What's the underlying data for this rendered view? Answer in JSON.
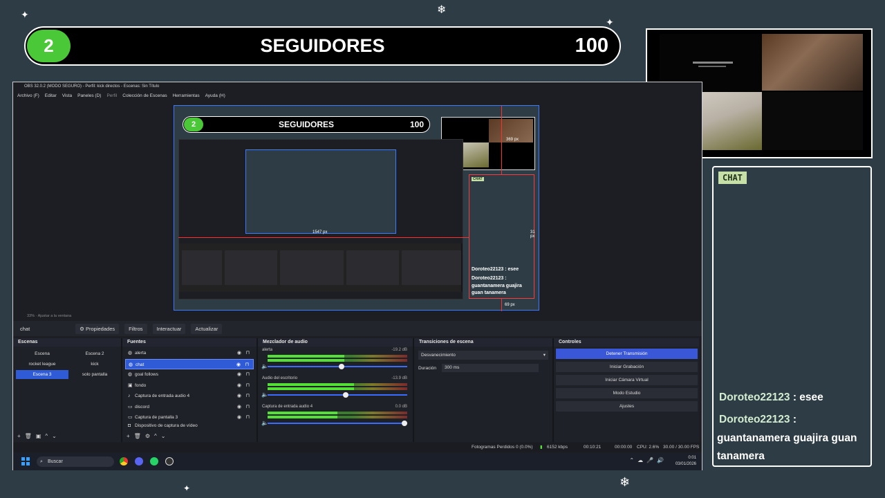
{
  "follower_goal": {
    "current": "2",
    "label": "SEGUIDORES",
    "goal": "100",
    "badge_color": "#4bc838"
  },
  "chat": {
    "tag": "CHAT",
    "messages": [
      {
        "user": "Doroteo22123",
        "separator": " : ",
        "text": "esee"
      },
      {
        "user": "Doroteo22123",
        "separator": " :",
        "text": "guantanamera guajira guan tanamera"
      }
    ]
  },
  "obs": {
    "title": "OBS 32.0.2 (MODO SEGURO) - Perfil: kick directos - Escenas: Sin Título",
    "menu": [
      "Archivo (F)",
      "Editar",
      "Vista",
      "Paneles (D)",
      "Perfil",
      "Colección de Escenas",
      "Herramientas",
      "Ayuda (H)"
    ],
    "preview": {
      "bar_current": "2",
      "bar_label": "SEGUIDORES",
      "bar_goal": "100",
      "chat_tag": "CHAT",
      "chat_lines": [
        "Doroteo22123 : esee",
        "Doroteo22123 :",
        "guantanamera guajira guan tanamera"
      ],
      "px_labels": [
        "369 px",
        "1547 px",
        "31 px",
        "69 px"
      ]
    },
    "canvas_info": "33% · Ajustar a la ventana",
    "current_source": "chat",
    "source_toolbar": [
      "⚙ Propiedades",
      "Filtros",
      "Interactuar",
      "Actualizar"
    ],
    "docks": {
      "scenes": {
        "title": "Escenas",
        "items": [
          "Escena",
          "Escena 2",
          "rocket league",
          "kick",
          "Escena 3",
          "solo pantalla"
        ],
        "active": "Escena 3"
      },
      "sources": {
        "title": "Fuentes",
        "items": [
          "alerta",
          "chat",
          "goal follows",
          "fondo",
          "Captura de entrada audio 4",
          "discord",
          "Captura de pantalla 3",
          "Dispositivo de captura de vídeo"
        ],
        "active": "chat"
      },
      "mixer": {
        "title": "Mezclador de audio",
        "channels": [
          {
            "name": "alerta",
            "db": "-19.2 dB",
            "level": 0.55,
            "fader": 0.55
          },
          {
            "name": "Audio del escritorio",
            "db": "-13.9 dB",
            "level": 0.62,
            "fader": 0.58
          },
          {
            "name": "Captura de entrada audio 4",
            "db": "0.0 dB",
            "level": 0.5,
            "fader": 1.0
          }
        ]
      },
      "transitions": {
        "title": "Transiciones de escena",
        "selected": "Desvanecimiento",
        "duration_label": "Duración",
        "duration_value": "300 ms"
      },
      "controls": {
        "title": "Controles",
        "buttons": [
          "Detener Transmisión",
          "Iniciar Grabación",
          "Iniciar Cámara Virtual",
          "Modo Estudio",
          "Ajustes"
        ]
      }
    },
    "status": {
      "dropped": "Fotogramas Perdidos 0 (0.0%)",
      "bitrate": "6152 kbps",
      "stream_time": "00:10:21",
      "rec_time": "00:00:00",
      "cpu": "CPU: 2.6%",
      "fps": "30.00 / 30.00 FPS"
    }
  },
  "taskbar": {
    "search_placeholder": "Buscar",
    "time": "0:01",
    "date": "03/01/2026"
  },
  "colors": {
    "background": "#2e3d45",
    "accent_blue": "#2f5bd6",
    "chat_tag_bg": "#c7e0a7"
  }
}
